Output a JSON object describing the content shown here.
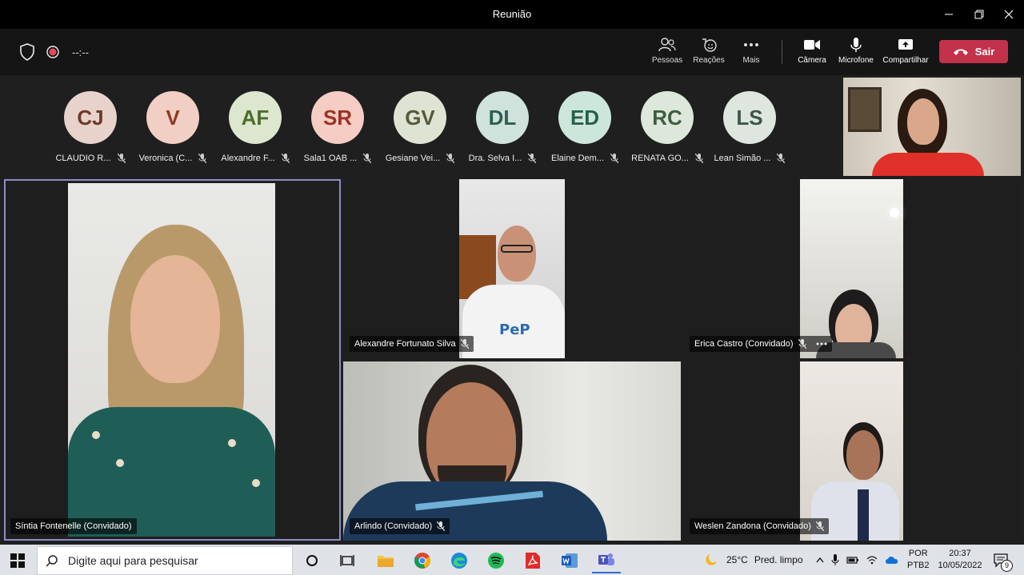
{
  "window": {
    "title": "Reunião"
  },
  "toolbar": {
    "timer": "--:--",
    "buttons": {
      "people": "Pessoas",
      "reactions": "Reações",
      "more": "Mais",
      "camera": "Câmera",
      "mic": "Microfone",
      "share": "Compartilhar"
    },
    "leave": "Sair"
  },
  "roster": [
    {
      "initials": "CJ",
      "name": "CLAUDIO R...",
      "color": "#e8d2cc",
      "text": "#6b3a2c"
    },
    {
      "initials": "V",
      "name": "Veronica (C...",
      "color": "#f1cfc4",
      "text": "#8c3b25"
    },
    {
      "initials": "AF",
      "name": "Alexandre F...",
      "color": "#dde6cf",
      "text": "#4e6b2c"
    },
    {
      "initials": "SR",
      "name": "Sala1 OAB ...",
      "color": "#f5cdc4",
      "text": "#9a3324"
    },
    {
      "initials": "GV",
      "name": "Gesiane Vei...",
      "color": "#dfe3d3",
      "text": "#555a3a"
    },
    {
      "initials": "DL",
      "name": "Dra. Selva I...",
      "color": "#cfe2dc",
      "text": "#2e5e51"
    },
    {
      "initials": "ED",
      "name": "Elaine Dem...",
      "color": "#cde6dc",
      "text": "#27604a"
    },
    {
      "initials": "RC",
      "name": "RENATA GO...",
      "color": "#dde7dc",
      "text": "#3f5c3f"
    },
    {
      "initials": "LS",
      "name": "Lean Simão ...",
      "color": "#dfe5df",
      "text": "#3e5548"
    }
  ],
  "tiles": {
    "sintia": "Síntia Fontenelle (Convidado)",
    "alexandre": "Alexandre Fortunato Silva",
    "erica": "Erica Castro (Convidado)",
    "arlindo": "Arlindo (Convidado)",
    "weslen": "Weslen Zandona (Convidado)"
  },
  "video_text": {
    "shirt_logo": "PeP"
  },
  "taskbar": {
    "search_placeholder": "Digite aqui para pesquisar",
    "weather_temp": "25°C",
    "weather_desc": "Pred. limpo",
    "lang_1": "POR",
    "lang_2": "PTB2",
    "time": "20:37",
    "date": "10/05/2022",
    "notifications": "9"
  }
}
